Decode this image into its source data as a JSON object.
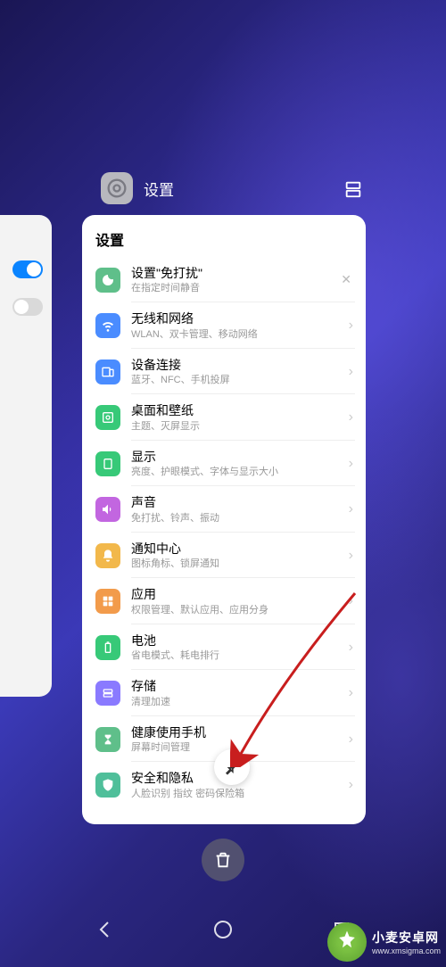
{
  "app": {
    "name": "设置",
    "icon": "settings-gear"
  },
  "card": {
    "title": "设置",
    "items": [
      {
        "icon": "moon",
        "color": "#5fbf8a",
        "title": "设置\"免打扰\"",
        "sub": "在指定时间静音",
        "close": true
      },
      {
        "icon": "wifi",
        "color": "#4a8cff",
        "title": "无线和网络",
        "sub": "WLAN、双卡管理、移动网络"
      },
      {
        "icon": "devices",
        "color": "#4a8cff",
        "title": "设备连接",
        "sub": "蓝牙、NFC、手机投屏"
      },
      {
        "icon": "desktop",
        "color": "#37c978",
        "title": "桌面和壁纸",
        "sub": "主题、灭屏显示"
      },
      {
        "icon": "display",
        "color": "#37c978",
        "title": "显示",
        "sub": "亮度、护眼模式、字体与显示大小"
      },
      {
        "icon": "sound",
        "color": "#c266e0",
        "title": "声音",
        "sub": "免打扰、铃声、振动"
      },
      {
        "icon": "bell",
        "color": "#f2b84b",
        "title": "通知中心",
        "sub": "图标角标、锁屏通知"
      },
      {
        "icon": "apps",
        "color": "#f29b4b",
        "title": "应用",
        "sub": "权限管理、默认应用、应用分身"
      },
      {
        "icon": "battery",
        "color": "#37c978",
        "title": "电池",
        "sub": "省电模式、耗电排行"
      },
      {
        "icon": "storage",
        "color": "#8a7aff",
        "title": "存储",
        "sub": "清理加速"
      },
      {
        "icon": "hourglass",
        "color": "#5fbf8a",
        "title": "健康使用手机",
        "sub": "屏幕时间管理"
      },
      {
        "icon": "shield",
        "color": "#4fbf9a",
        "title": "安全和隐私",
        "sub": "人脸识别  指纹         密码保险箱"
      }
    ]
  },
  "watermark": {
    "line1": "小麦安卓网",
    "line2": "www.xmsigma.com"
  }
}
